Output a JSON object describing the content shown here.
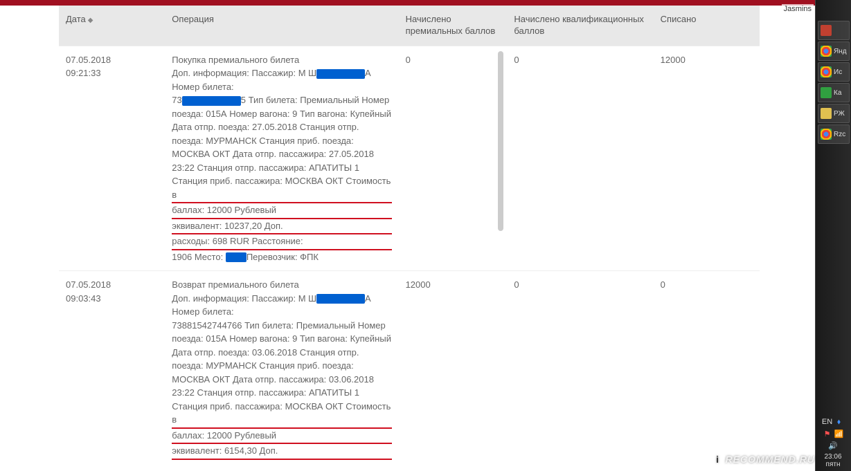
{
  "browser_user": "Jasmins",
  "headers": {
    "date": "Дата",
    "operation": "Операция",
    "premium_points": "Начислено премиальных баллов",
    "qual_points": "Начислено квалификационных баллов",
    "debited": "Списано"
  },
  "rows": [
    {
      "date": "07.05.2018",
      "time": "09:21:33",
      "op_title": "Покупка премиального билета",
      "op_prefix": "Доп. информация: Пассажир: М Ш",
      "op_suffix": "А",
      "ticket_label": "Номер билета:",
      "ticket_pre": "73",
      "ticket_post": "5 Тип билета: Премиальный Номер поезда: 015А Номер вагона: 9 Тип вагона: Купейный Дата отпр. поезда: 27.05.2018 Станция отпр. поезда: МУРМАНСК Станция приб. поезда: МОСКВА ОКТ Дата отпр. пассажира: 27.05.2018 23:22 Станция отпр. пассажира: АПАТИТЫ 1 Станция приб. пассажира: МОСКВА ОКТ",
      "cost_line1": "Стоимость в",
      "cost_line2": "баллах: 12000 Рублевый",
      "cost_line3": "эквивалент: 10237,20 Доп.",
      "cost_line4": "расходы: 698 RUR Расстояние:",
      "tail_pre": "1906 Место:",
      "tail_post": "Перевозчик: ФПК",
      "premium": "0",
      "qual": "0",
      "debited": "12000"
    },
    {
      "date": "07.05.2018",
      "time": "09:03:43",
      "op_title": "Возврат премиального билета",
      "op_prefix": "Доп. информация: Пассажир: М Ш",
      "op_suffix": "А",
      "ticket_label": "Номер билета:",
      "ticket_full": "73881542744766 Тип билета: Премиальный Номер поезда: 015А Номер вагона: 9 Тип вагона: Купейный Дата отпр. поезда: 03.06.2018 Станция отпр. поезда: МУРМАНСК Станция приб. поезда: МОСКВА ОКТ Дата отпр. пассажира: 03.06.2018 23:22 Станция отпр. пассажира: АПАТИТЫ 1 Станция приб. пассажира: МОСКВА ОКТ",
      "cost_line1": "Стоимость в",
      "cost_line2": "баллах: 12000 Рублевый",
      "cost_line3": "эквивалент: 6154,30 Доп.",
      "premium": "12000",
      "qual": "0",
      "debited": "0"
    }
  ],
  "taskbar": [
    {
      "label": "",
      "color": "#c04030"
    },
    {
      "label": "Янд",
      "color": "#e0b020"
    },
    {
      "label": "Ис",
      "color": "#3080e0"
    },
    {
      "label": "Ка",
      "color": "#30a040"
    },
    {
      "label": "РЖ",
      "color": "#d04040"
    },
    {
      "label": "Rzс",
      "color": "#e0c050"
    }
  ],
  "sys": {
    "lang": "EN",
    "time": "23:06",
    "day": "пятн"
  },
  "watermark": "RECOMMEND.RU"
}
